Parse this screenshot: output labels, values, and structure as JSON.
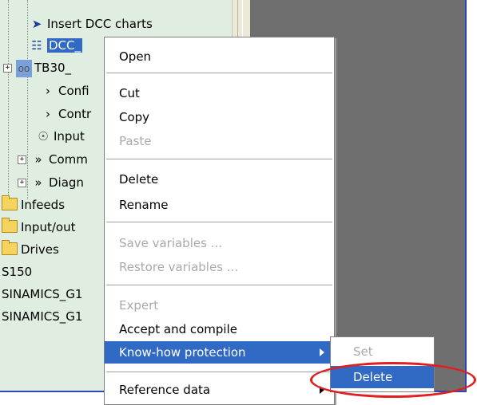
{
  "tree": {
    "items": [
      {
        "label": "Insert DCC charts",
        "icon": "insert-chart-icon"
      },
      {
        "label": "DCC_",
        "icon": "dcc-chart-icon",
        "selected": true
      },
      {
        "label": "TB30_",
        "icon": "module-icon"
      },
      {
        "label": "Confi",
        "icon": "chevron-right-icon"
      },
      {
        "label": "Contr",
        "icon": "chevron-right-icon"
      },
      {
        "label": "Input",
        "icon": "input-plug-icon"
      },
      {
        "label": "Comm",
        "icon": "double-chevron-icon"
      },
      {
        "label": "Diagn",
        "icon": "double-chevron-icon"
      },
      {
        "label": "Infeeds",
        "icon": "folder-icon"
      },
      {
        "label": "Input/out",
        "icon": "folder-icon"
      },
      {
        "label": "Drives",
        "icon": "folder-icon"
      },
      {
        "label": "S150",
        "icon": ""
      },
      {
        "label": "SINAMICS_G1",
        "icon": ""
      },
      {
        "label": "SINAMICS_G1",
        "icon": ""
      }
    ]
  },
  "context_menu": {
    "open": "Open",
    "cut": "Cut",
    "copy": "Copy",
    "paste": "Paste",
    "delete": "Delete",
    "rename": "Rename",
    "save_variables": "Save variables ...",
    "restore_variables": "Restore variables ...",
    "expert": "Expert",
    "accept_compile": "Accept and compile",
    "know_how": "Know-how protection",
    "reference_data": "Reference data"
  },
  "submenu": {
    "set": "Set",
    "delete": "Delete"
  },
  "colors": {
    "highlight": "#316ac5",
    "tree_bg": "#dfeee0",
    "annotation_ring": "#e02020"
  }
}
